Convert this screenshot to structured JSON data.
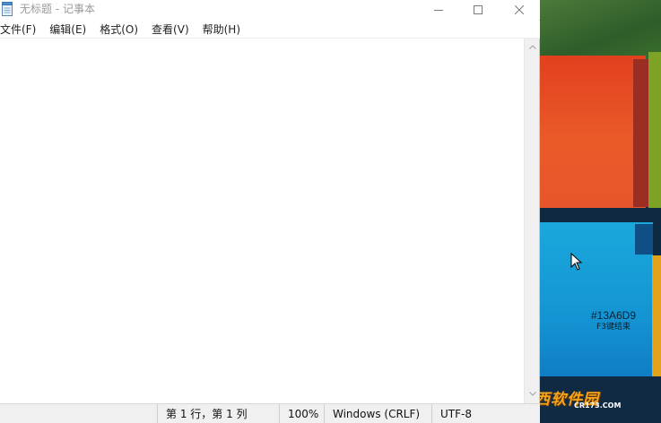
{
  "window": {
    "title": "无标题 - 记事本",
    "menu": [
      "文件(F)",
      "编辑(E)",
      "格式(O)",
      "查看(V)",
      "帮助(H)"
    ],
    "editor_text": "",
    "status": {
      "position": "第 1 行，第 1 列",
      "zoom": "100%",
      "line_ending": "Windows (CRLF)",
      "encoding": "UTF-8"
    }
  },
  "desktop": {
    "color_hex": "#13A6D9",
    "color_hint": "F3键结束",
    "watermark": "西西软件园",
    "watermark_sub": "CR173.COM"
  },
  "colors": {
    "wallpaper_blue": "#13A6D9",
    "wallpaper_red": "#E6562A",
    "wallpaper_green": "#3B6F2D",
    "watermark_orange": "#F6A41B"
  },
  "icons": [
    "notepad-icon",
    "minimize-icon",
    "maximize-icon",
    "close-icon",
    "scroll-up-icon",
    "scroll-down-icon",
    "mouse-cursor-icon",
    "watermark-logo-icon"
  ]
}
